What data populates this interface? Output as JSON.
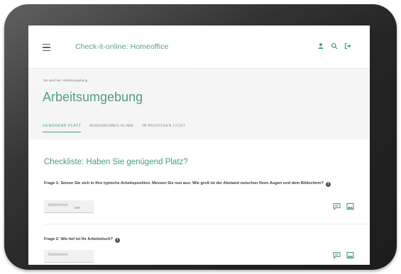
{
  "app": {
    "title": "Check-it-online: Homeoffice"
  },
  "header": {
    "icons": [
      "user-icon",
      "search-icon",
      "logout-icon"
    ]
  },
  "page": {
    "breadcrumb": "Sie sind hier: Arbeitsumgebung",
    "title": "Arbeitsumgebung"
  },
  "tabs": [
    {
      "label": "GENÜGEND PLATZ",
      "active": true
    },
    {
      "label": "ANGENEHMES KLIMA",
      "active": false
    },
    {
      "label": "IM RICHTIGEN LICHT",
      "active": false
    }
  ],
  "checklist": {
    "title": "Checkliste: Haben Sie genügend Platz?",
    "questions": [
      {
        "text": "Frage 1: Setzen Sie sich in Ihre typische Arbeitsposition. Messen Sie nun aus: Wie groß ist der Abstand zwischen Ihren Augen und dem Bildschirm?",
        "placeholder": "Maßeinheit",
        "unit": "cm"
      },
      {
        "text": "Frage 2: Wie tief ist Ihr Arbeitstisch?",
        "placeholder": "Maßeinheit",
        "unit": ""
      }
    ]
  },
  "colors": {
    "accent": "#4a9c78",
    "hero_bg": "#f5f5f5",
    "frame": "#2a2a2a"
  }
}
